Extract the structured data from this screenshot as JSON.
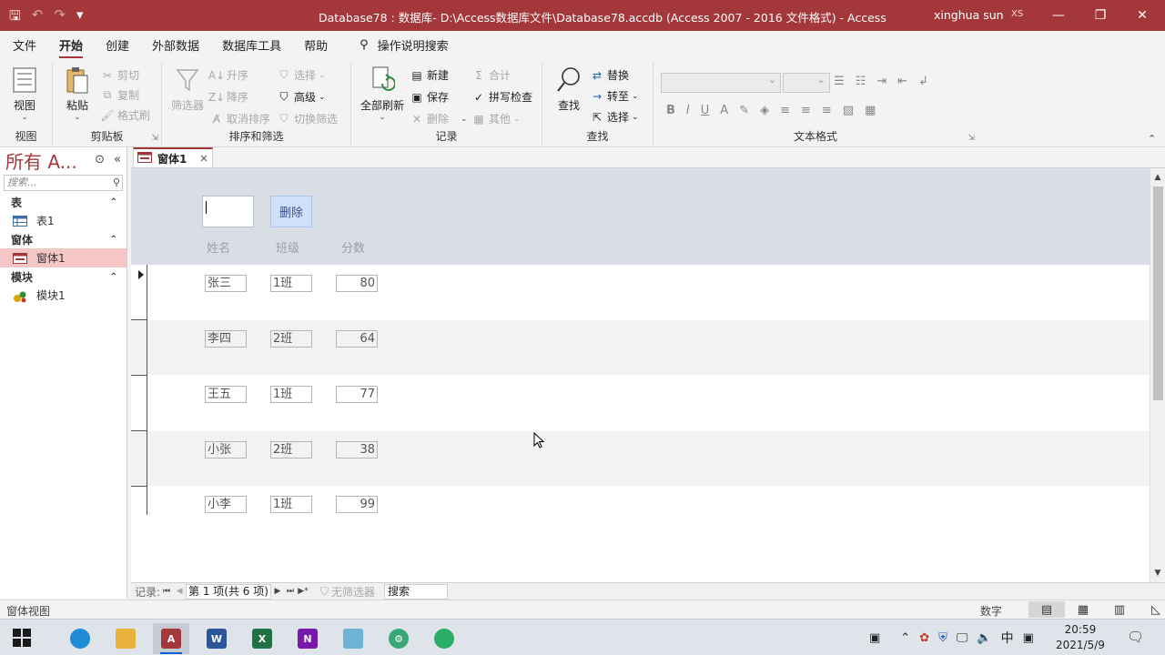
{
  "titlebar": {
    "title": "Database78 : 数据库- D:\\Access数据库文件\\Database78.accdb (Access 2007 - 2016 文件格式)  -  Access",
    "user": "xinghua sun",
    "initials": "XS"
  },
  "menu": {
    "tabs": [
      "文件",
      "开始",
      "创建",
      "外部数据",
      "数据库工具",
      "帮助"
    ],
    "active": "开始",
    "search": "操作说明搜索"
  },
  "ribbon": {
    "view": {
      "button": "视图",
      "group": "视图"
    },
    "clipboard": {
      "paste": "粘贴",
      "cut": "剪切",
      "copy": "复制",
      "format_painter": "格式刷",
      "group": "剪贴板"
    },
    "sort": {
      "filter": "筛选器",
      "asc": "升序",
      "desc": "降序",
      "remove_sort": "取消排序",
      "select": "选择",
      "advanced": "高级",
      "toggle_filter": "切换筛选",
      "group": "排序和筛选"
    },
    "records": {
      "refresh": "全部刷新",
      "new": "新建",
      "save": "保存",
      "delete": "删除",
      "totals": "合计",
      "spelling": "拼写检查",
      "more": "其他",
      "group": "记录"
    },
    "find": {
      "find": "查找",
      "replace": "替换",
      "goto": "转至",
      "select": "选择",
      "group": "查找"
    },
    "text_format": {
      "group": "文本格式"
    }
  },
  "nav": {
    "header": "所有 A...",
    "search_placeholder": "搜索...",
    "sections": [
      {
        "label": "表",
        "items": [
          "表1"
        ]
      },
      {
        "label": "窗体",
        "items": [
          "窗体1"
        ]
      },
      {
        "label": "模块",
        "items": [
          "模块1"
        ]
      }
    ]
  },
  "doc_tab": "窗体1",
  "form": {
    "delete_button": "删除",
    "headers": [
      "姓名",
      "班级",
      "分数"
    ],
    "rows": [
      {
        "name": "张三",
        "class": "1班",
        "score": "80"
      },
      {
        "name": "李四",
        "class": "2班",
        "score": "64"
      },
      {
        "name": "王五",
        "class": "1班",
        "score": "77"
      },
      {
        "name": "小张",
        "class": "2班",
        "score": "38"
      },
      {
        "name": "小李",
        "class": "1班",
        "score": "99"
      }
    ]
  },
  "record_nav": {
    "label": "记录:",
    "position": "第 1 项(共 6 项)",
    "filter": "无筛选器",
    "search": "搜索"
  },
  "status": {
    "left": "窗体视图",
    "numlock": "数字"
  },
  "clock": {
    "time": "20:59",
    "date": "2021/5/9"
  },
  "tray": {
    "ime": "中"
  },
  "colors": {
    "accent": "#a4373a",
    "form_header": "#d9dde6",
    "selected_nav": "#f4c6c6"
  }
}
